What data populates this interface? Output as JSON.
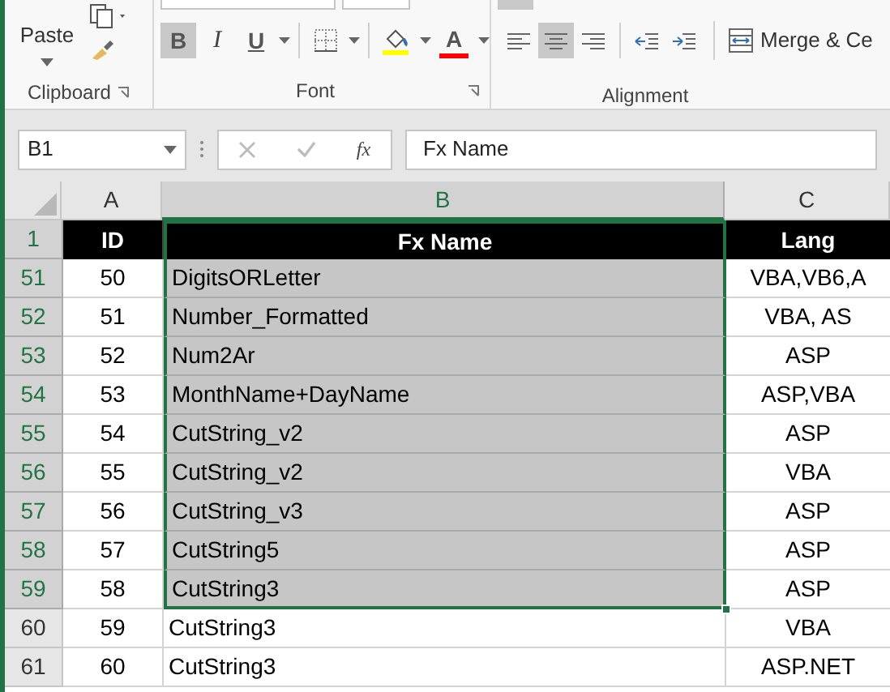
{
  "ribbon": {
    "paste_label": "Paste",
    "groups": [
      {
        "label": "Clipboard"
      },
      {
        "label": "Font"
      },
      {
        "label": "Alignment"
      }
    ],
    "font_tools": [
      {
        "kind": "text",
        "label": "B",
        "selected": true,
        "dropdown": false
      },
      {
        "kind": "text",
        "label": "I",
        "selected": false,
        "dropdown": false
      },
      {
        "kind": "text",
        "label": "U",
        "selected": false,
        "dropdown": true
      },
      {
        "kind": "borders",
        "selected": false,
        "dropdown": true
      },
      {
        "kind": "fill",
        "selected": false,
        "dropdown": true,
        "color": "#ffff00"
      },
      {
        "kind": "text",
        "label": "A",
        "selected": false,
        "dropdown": true,
        "color": "#ff0000"
      }
    ],
    "align_tools": [
      {
        "kind": "align-left",
        "selected": false
      },
      {
        "kind": "align-center",
        "selected": true
      },
      {
        "kind": "align-right",
        "selected": false
      },
      {
        "kind": "indent-decrease",
        "selected": false
      },
      {
        "kind": "indent-increase",
        "selected": false
      }
    ],
    "merge_label": "Merge & Ce"
  },
  "formula_bar": {
    "name_box": "B1",
    "fx_label": "fx",
    "value": "Fx Name"
  },
  "columns": [
    {
      "label": "A",
      "selected": false
    },
    {
      "label": "B",
      "selected": true
    },
    {
      "label": "C",
      "selected": false
    }
  ],
  "rows": [
    {
      "number": "1",
      "kind": "header",
      "selected": true,
      "cells": [
        "ID",
        "Fx Name",
        "Lang"
      ]
    },
    {
      "number": "51",
      "kind": "data",
      "selected": true,
      "cells": [
        "50",
        "DigitsORLetter",
        "VBA,VB6,A"
      ]
    },
    {
      "number": "52",
      "kind": "data",
      "selected": true,
      "cells": [
        "51",
        "Number_Formatted",
        "VBA, AS"
      ]
    },
    {
      "number": "53",
      "kind": "data",
      "selected": true,
      "cells": [
        "52",
        "Num2Ar",
        "ASP"
      ]
    },
    {
      "number": "54",
      "kind": "data",
      "selected": true,
      "cells": [
        "53",
        "MonthName+DayName",
        "ASP,VBA"
      ]
    },
    {
      "number": "55",
      "kind": "data",
      "selected": true,
      "cells": [
        "54",
        "CutString_v2",
        "ASP"
      ]
    },
    {
      "number": "56",
      "kind": "data",
      "selected": true,
      "cells": [
        "55",
        "CutString_v2",
        "VBA"
      ]
    },
    {
      "number": "57",
      "kind": "data",
      "selected": true,
      "cells": [
        "56",
        "CutString_v3",
        "ASP"
      ]
    },
    {
      "number": "58",
      "kind": "data",
      "selected": true,
      "cells": [
        "57",
        "CutString5",
        "ASP"
      ]
    },
    {
      "number": "59",
      "kind": "data",
      "selected": true,
      "cells": [
        "58",
        "CutString3",
        "ASP"
      ]
    },
    {
      "number": "60",
      "kind": "data",
      "selected": false,
      "cells": [
        "59",
        "CutString3",
        "VBA"
      ]
    },
    {
      "number": "61",
      "kind": "data",
      "selected": false,
      "cells": [
        "60",
        "CutString3",
        "ASP.NET"
      ]
    }
  ]
}
